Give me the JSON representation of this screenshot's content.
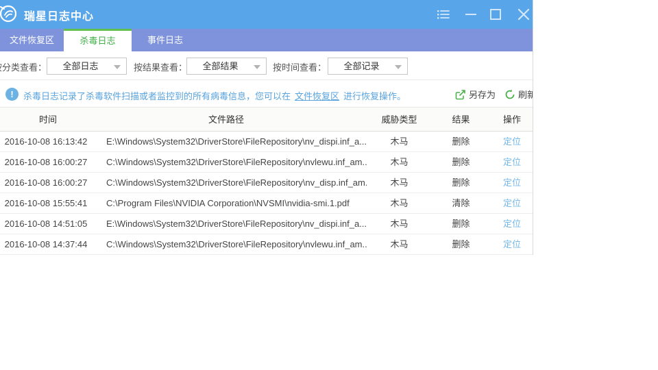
{
  "window": {
    "title": "瑞星日志中心"
  },
  "tabs": [
    {
      "label": "文件恢复区",
      "active": false
    },
    {
      "label": "杀毒日志",
      "active": true
    },
    {
      "label": "事件日志",
      "active": false
    }
  ],
  "filters": [
    {
      "label": "按分类查看：",
      "value": "全部日志"
    },
    {
      "label": "按结果查看：",
      "value": "全部结果"
    },
    {
      "label": "按时间查看：",
      "value": "全部记录"
    }
  ],
  "info": {
    "icon": "!",
    "text_before": "杀毒日志记录了杀毒软件扫描或者监控到的所有病毒信息，您可以在",
    "link": "文件恢复区",
    "text_after": "进行恢复操作。"
  },
  "toolbar": {
    "save_as_label": "另存为",
    "refresh_label": "刷新"
  },
  "table": {
    "headers": {
      "time": "时间",
      "path": "文件路径",
      "threat": "威胁类型",
      "result": "结果",
      "action": "操作"
    },
    "rows": [
      {
        "time": "2016-10-08 16:13:42",
        "path": "E:\\Windows\\System32\\DriverStore\\FileRepository\\nv_dispi.inf_a...",
        "threat": "木马",
        "result": "删除",
        "action": "定位"
      },
      {
        "time": "2016-10-08 16:00:27",
        "path": "C:\\Windows\\System32\\DriverStore\\FileRepository\\nvlewu.inf_am...",
        "threat": "木马",
        "result": "删除",
        "action": "定位"
      },
      {
        "time": "2016-10-08 16:00:27",
        "path": "C:\\Windows\\System32\\DriverStore\\FileRepository\\nv_disp.inf_am...",
        "threat": "木马",
        "result": "删除",
        "action": "定位"
      },
      {
        "time": "2016-10-08 15:55:41",
        "path": "C:\\Program Files\\NVIDIA Corporation\\NVSMI\\nvidia-smi.1.pdf",
        "threat": "木马",
        "result": "清除",
        "action": "定位"
      },
      {
        "time": "2016-10-08 14:51:05",
        "path": "E:\\Windows\\System32\\DriverStore\\FileRepository\\nv_dispi.inf_a...",
        "threat": "木马",
        "result": "删除",
        "action": "定位"
      },
      {
        "time": "2016-10-08 14:37:44",
        "path": "C:\\Windows\\System32\\DriverStore\\FileRepository\\nvlewu.inf_am...",
        "threat": "木马",
        "result": "删除",
        "action": "定位"
      }
    ]
  },
  "colors": {
    "titlebar": "#58a6e9",
    "tabbar": "#7e93dc",
    "active_tab_green": "#3fae47",
    "tab_top_border": "#63c04e",
    "info_blue": "#58a3dd",
    "action_link_blue": "#74b7e8",
    "tool_icon_green": "#4cb04c"
  }
}
